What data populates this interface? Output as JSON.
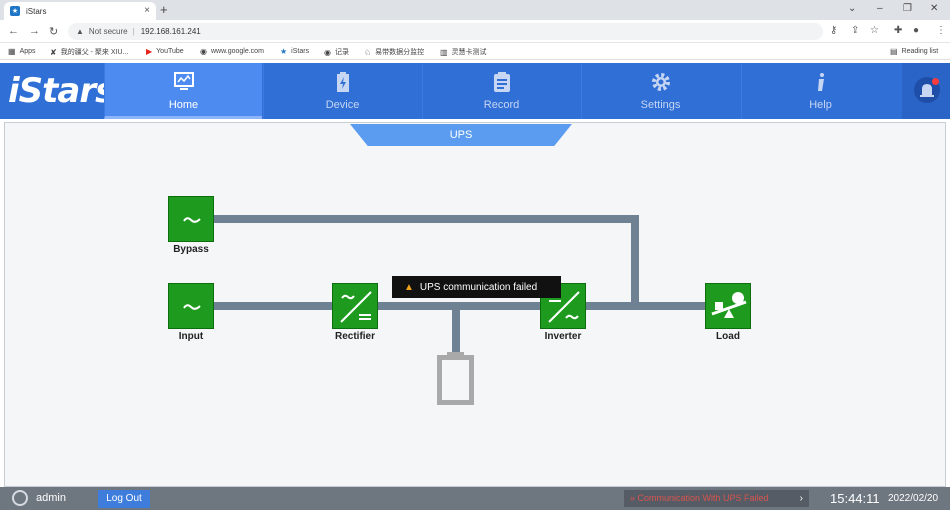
{
  "browser": {
    "tab_title": "iStars",
    "tab_close": "×",
    "new_tab": "+",
    "url_warning": "Not secure",
    "url_separator": "|",
    "url_host": "192.168.161.241",
    "window_controls": [
      "⌄",
      "–",
      "❐",
      "✕"
    ]
  },
  "bookmarks": {
    "items": [
      "Apps",
      "我的疆父 - 聚来 XIU...",
      "YouTube",
      "www.google.com",
      "iStars",
      "记录",
      "易带数据分监控",
      "灵慧卡测试"
    ],
    "reading_list": "Reading list"
  },
  "app": {
    "logo": "iStars",
    "nav": [
      {
        "label": "Home",
        "icon": "monitor-icon",
        "active": true
      },
      {
        "label": "Device",
        "icon": "battery-device-icon",
        "active": false
      },
      {
        "label": "Record",
        "icon": "clipboard-icon",
        "active": false
      },
      {
        "label": "Settings",
        "icon": "gear-icon",
        "active": false
      },
      {
        "label": "Help",
        "icon": "info-icon",
        "active": false
      }
    ]
  },
  "main": {
    "section_tab": "UPS",
    "blocks": {
      "bypass": "Bypass",
      "input": "Input",
      "rectifier": "Rectifier",
      "inverter": "Inverter",
      "load": "Load"
    },
    "toast": "UPS communication failed"
  },
  "footer": {
    "username": "admin",
    "logout": "Log Out",
    "alarm": "» Communication With UPS Failed",
    "alarm_arrow": "›",
    "time": "15:44:11",
    "date": "2022/02/20"
  },
  "colors": {
    "header": "#2f6fd6",
    "active_tab": "#4d8bf0",
    "block_green": "#1e9b1e",
    "line": "#6e8293",
    "footer": "#6e7680",
    "alarm_text": "#d9534f"
  }
}
